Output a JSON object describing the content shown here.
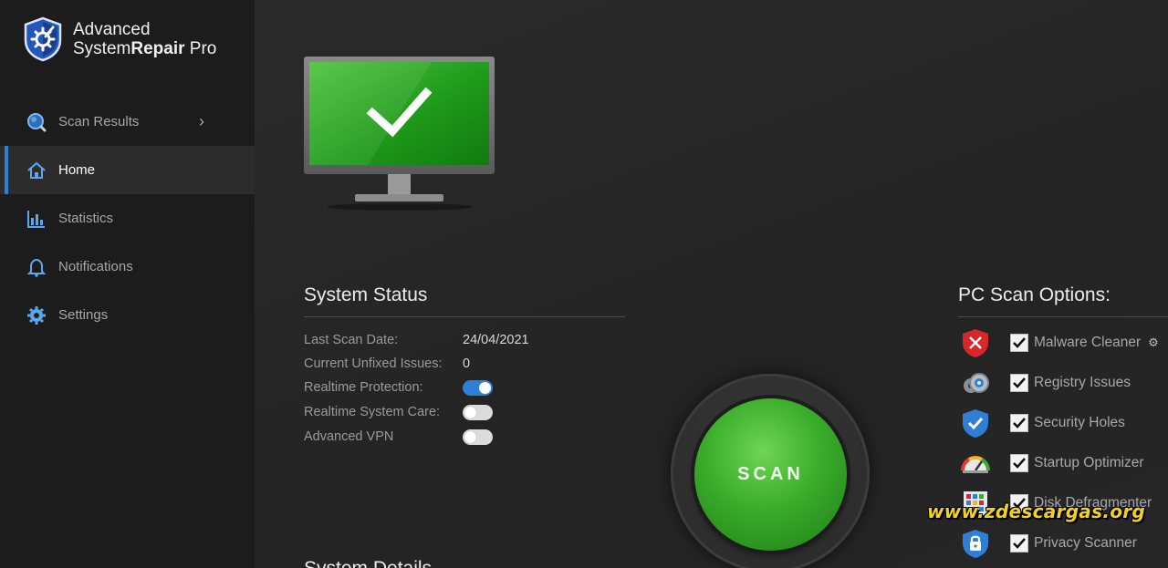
{
  "app": {
    "name_line1": "Advanced",
    "name_line2_regular": "System",
    "name_line2_bold": "Repair",
    "name_line2_suffix": " Pro"
  },
  "sidebar": {
    "items": [
      {
        "label": "Scan Results",
        "icon": "magnifier-icon",
        "has_chevron": true
      },
      {
        "label": "Home",
        "icon": "home-icon",
        "active": true
      },
      {
        "label": "Statistics",
        "icon": "bar-chart-icon"
      },
      {
        "label": "Notifications",
        "icon": "bell-icon"
      },
      {
        "label": "Settings",
        "icon": "gear-icon"
      }
    ],
    "chevron": "›"
  },
  "colors": {
    "accent": "#2f7fd6",
    "scan_green": "#3aac2a",
    "watermark": "#f3d21b"
  },
  "system_status": {
    "title": "System Status",
    "rows": [
      {
        "label": "Last Scan Date:",
        "value": "24/04/2021"
      },
      {
        "label": "Current Unfixed Issues:",
        "value": "0"
      },
      {
        "label": "Realtime Protection:",
        "toggle": "on"
      },
      {
        "label": "Realtime System Care:",
        "toggle": "off"
      },
      {
        "label": "Advanced VPN",
        "toggle": "off"
      }
    ]
  },
  "system_details": {
    "title": "System Details"
  },
  "scan": {
    "label": "SCAN"
  },
  "scan_options": {
    "title": "PC Scan Options:",
    "items": [
      {
        "label": "Malware Cleaner",
        "icon": "shield-x-icon",
        "checked": true,
        "has_settings": true
      },
      {
        "label": "Registry Issues",
        "icon": "cogs-icon",
        "checked": true
      },
      {
        "label": "Security Holes",
        "icon": "shield-check-icon",
        "checked": true
      },
      {
        "label": "Startup Optimizer",
        "icon": "speedometer-icon",
        "checked": true
      },
      {
        "label": "Disk Defragmenter",
        "icon": "disk-grid-icon",
        "checked": true
      },
      {
        "label": "Privacy Scanner",
        "icon": "shield-lock-icon",
        "checked": true
      }
    ]
  },
  "watermark": {
    "text": "www.zdescargas.org"
  }
}
